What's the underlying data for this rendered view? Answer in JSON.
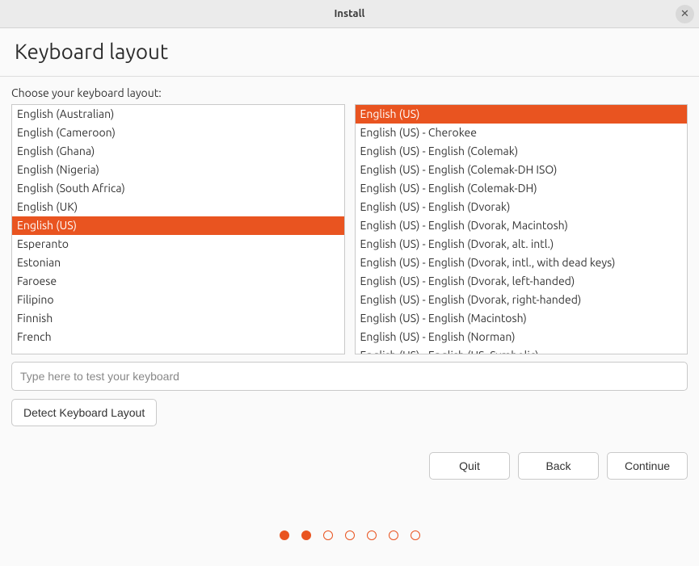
{
  "window": {
    "title": "Install"
  },
  "header": {
    "title": "Keyboard layout"
  },
  "instruction": "Choose your keyboard layout:",
  "layouts": {
    "items": [
      {
        "label": "English (Australian)",
        "selected": false
      },
      {
        "label": "English (Cameroon)",
        "selected": false
      },
      {
        "label": "English (Ghana)",
        "selected": false
      },
      {
        "label": "English (Nigeria)",
        "selected": false
      },
      {
        "label": "English (South Africa)",
        "selected": false
      },
      {
        "label": "English (UK)",
        "selected": false
      },
      {
        "label": "English (US)",
        "selected": true
      },
      {
        "label": "Esperanto",
        "selected": false
      },
      {
        "label": "Estonian",
        "selected": false
      },
      {
        "label": "Faroese",
        "selected": false
      },
      {
        "label": "Filipino",
        "selected": false
      },
      {
        "label": "Finnish",
        "selected": false
      },
      {
        "label": "French",
        "selected": false
      }
    ]
  },
  "variants": {
    "items": [
      {
        "label": "English (US)",
        "selected": true
      },
      {
        "label": "English (US) - Cherokee",
        "selected": false
      },
      {
        "label": "English (US) - English (Colemak)",
        "selected": false
      },
      {
        "label": "English (US) - English (Colemak-DH ISO)",
        "selected": false
      },
      {
        "label": "English (US) - English (Colemak-DH)",
        "selected": false
      },
      {
        "label": "English (US) - English (Dvorak)",
        "selected": false
      },
      {
        "label": "English (US) - English (Dvorak, Macintosh)",
        "selected": false
      },
      {
        "label": "English (US) - English (Dvorak, alt. intl.)",
        "selected": false
      },
      {
        "label": "English (US) - English (Dvorak, intl., with dead keys)",
        "selected": false
      },
      {
        "label": "English (US) - English (Dvorak, left-handed)",
        "selected": false
      },
      {
        "label": "English (US) - English (Dvorak, right-handed)",
        "selected": false
      },
      {
        "label": "English (US) - English (Macintosh)",
        "selected": false
      },
      {
        "label": "English (US) - English (Norman)",
        "selected": false
      },
      {
        "label": "English (US) - English (US, Symbolic)",
        "selected": false
      }
    ]
  },
  "test": {
    "placeholder": "Type here to test your keyboard"
  },
  "detect": {
    "label": "Detect Keyboard Layout"
  },
  "nav": {
    "quit": "Quit",
    "back": "Back",
    "continue": "Continue"
  },
  "progress": {
    "dots": [
      true,
      true,
      false,
      false,
      false,
      false,
      false
    ]
  }
}
